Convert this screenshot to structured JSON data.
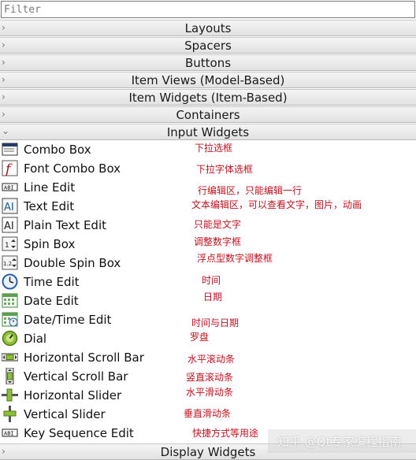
{
  "filter": {
    "placeholder": "Filter"
  },
  "categories": {
    "layouts": "Layouts",
    "spacers": "Spacers",
    "buttons": "Buttons",
    "item_views": "Item Views (Model-Based)",
    "item_widgets": "Item Widgets (Item-Based)",
    "containers": "Containers",
    "input_widgets": "Input Widgets",
    "display_widgets": "Display Widgets"
  },
  "items": [
    {
      "label": "Combo Box",
      "icon": "combo-box-icon",
      "note": "下拉选框"
    },
    {
      "label": "Font Combo Box",
      "icon": "font-combo-box-icon",
      "note": "下拉字体选框"
    },
    {
      "label": "Line Edit",
      "icon": "line-edit-icon",
      "note": "行编辑区，只能编辑一行"
    },
    {
      "label": "Text Edit",
      "icon": "text-edit-icon",
      "note": "文本编辑区，可以查看文字，图片，动画"
    },
    {
      "label": "Plain Text Edit",
      "icon": "plain-text-edit-icon",
      "note": "只能是文字"
    },
    {
      "label": "Spin Box",
      "icon": "spin-box-icon",
      "note": "调整数字框"
    },
    {
      "label": "Double Spin Box",
      "icon": "double-spin-box-icon",
      "note": "浮点型数字调整框"
    },
    {
      "label": "Time Edit",
      "icon": "clock-icon",
      "note": "时间"
    },
    {
      "label": "Date Edit",
      "icon": "calendar-icon",
      "note": "日期"
    },
    {
      "label": "Date/Time Edit",
      "icon": "calendar-clock-icon",
      "note": "时间与日期"
    },
    {
      "label": "Dial",
      "icon": "dial-icon",
      "note": "罗盘"
    },
    {
      "label": "Horizontal Scroll Bar",
      "icon": "horizontal-scrollbar-icon",
      "note": "水平滚动条"
    },
    {
      "label": "Vertical Scroll Bar",
      "icon": "vertical-scrollbar-icon",
      "note": "竖直滚动条"
    },
    {
      "label": "Horizontal Slider",
      "icon": "horizontal-slider-icon",
      "note": "水平滑动条"
    },
    {
      "label": "Vertical Slider",
      "icon": "vertical-slider-icon",
      "note": "垂直滑动条"
    },
    {
      "label": "Key Sequence Edit",
      "icon": "key-sequence-icon",
      "note": "快捷方式等用途"
    }
  ],
  "watermark": "知乎 @Qt专家编程指南",
  "colors": {
    "note": "#c1121f",
    "category_bg": "#e8e8e8"
  }
}
